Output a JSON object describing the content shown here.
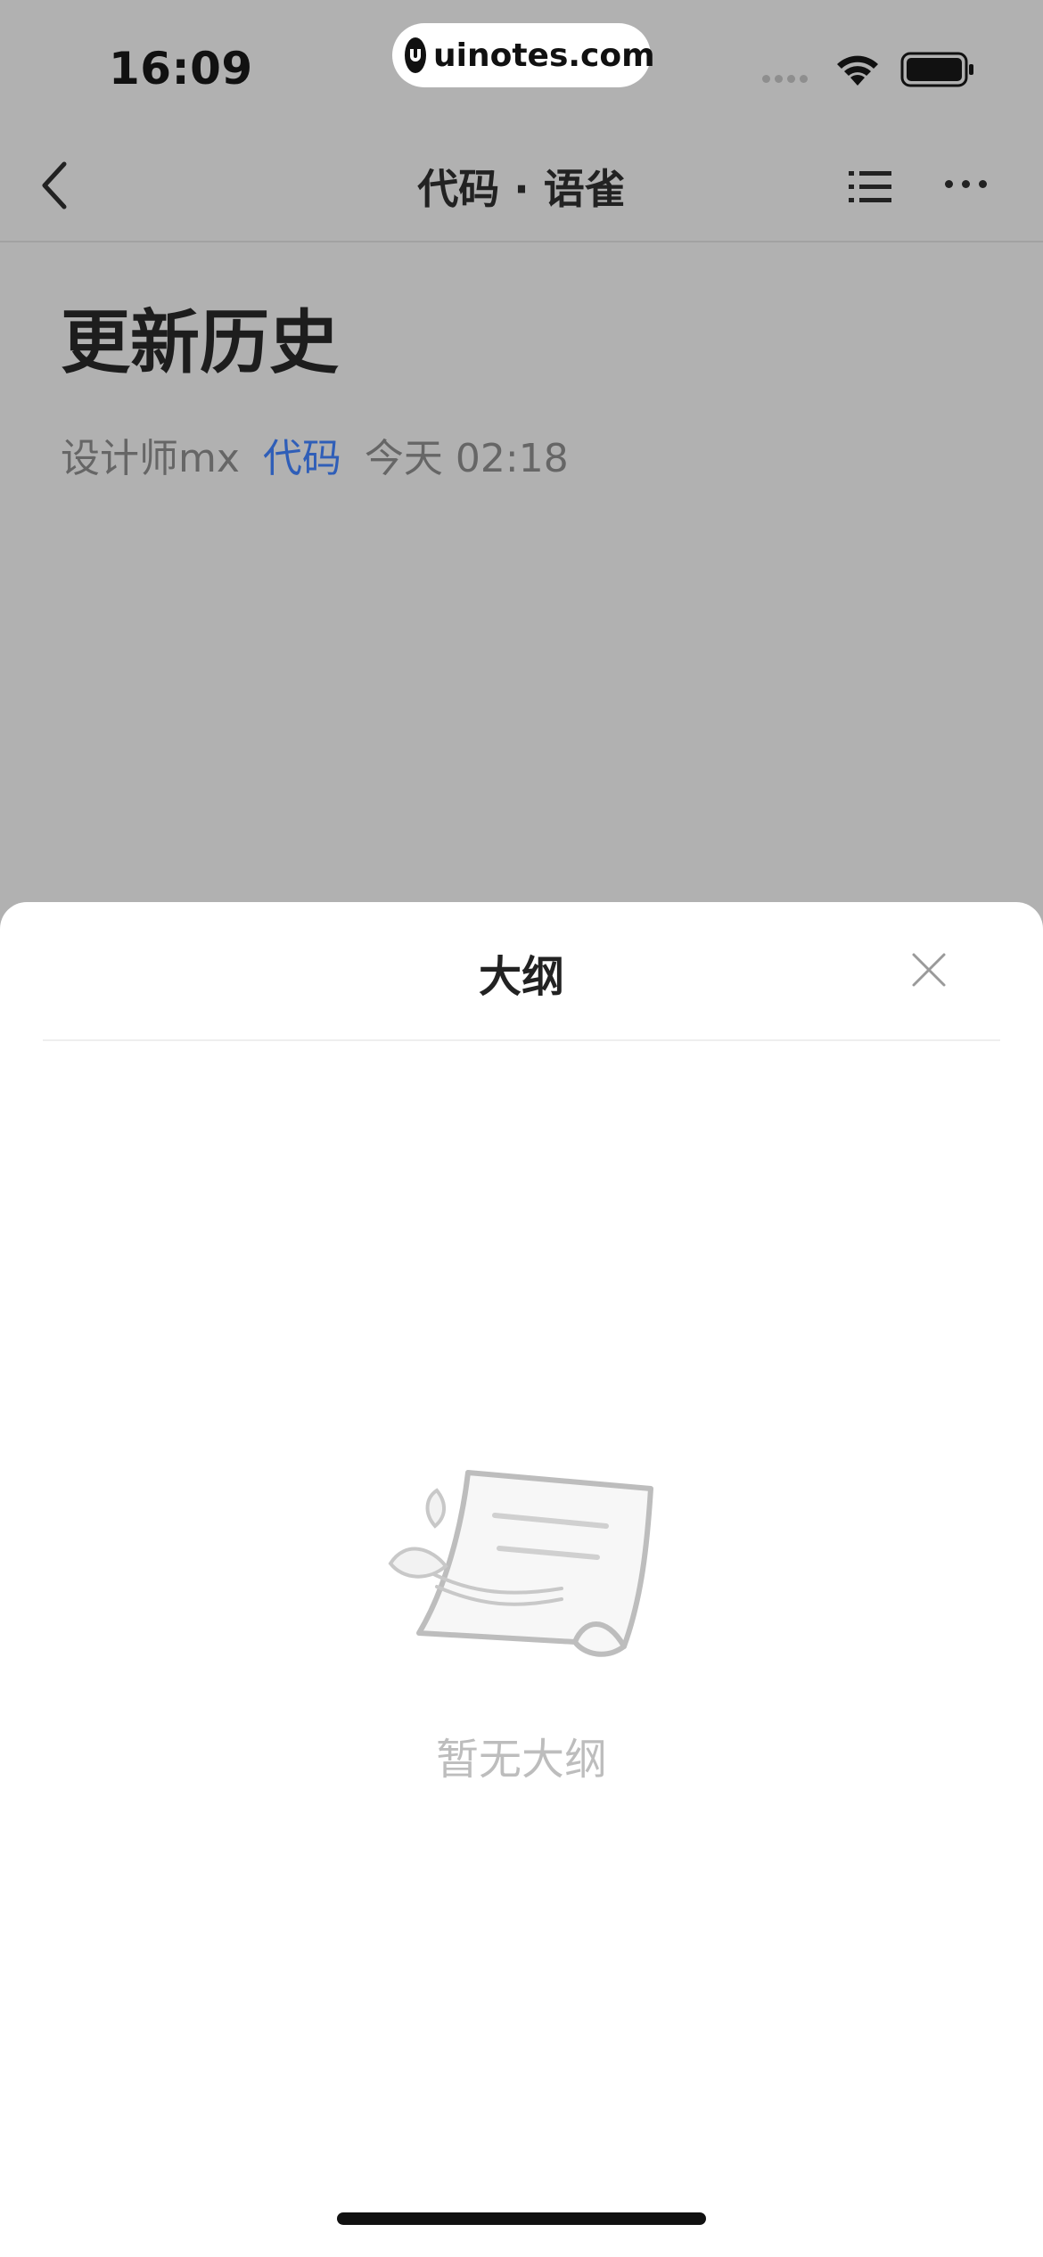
{
  "status_bar": {
    "time": "16:09",
    "watermark": "uinotes.com"
  },
  "nav": {
    "title": "代码 · 语雀"
  },
  "document": {
    "title": "更新历史",
    "author": "设计师mx",
    "book": "代码",
    "date": "今天 02:18"
  },
  "sheet": {
    "title": "大纲",
    "empty_text": "暂无大纲"
  },
  "colors": {
    "link": "#2f5eb8",
    "overlay": "#b1b1b1"
  }
}
